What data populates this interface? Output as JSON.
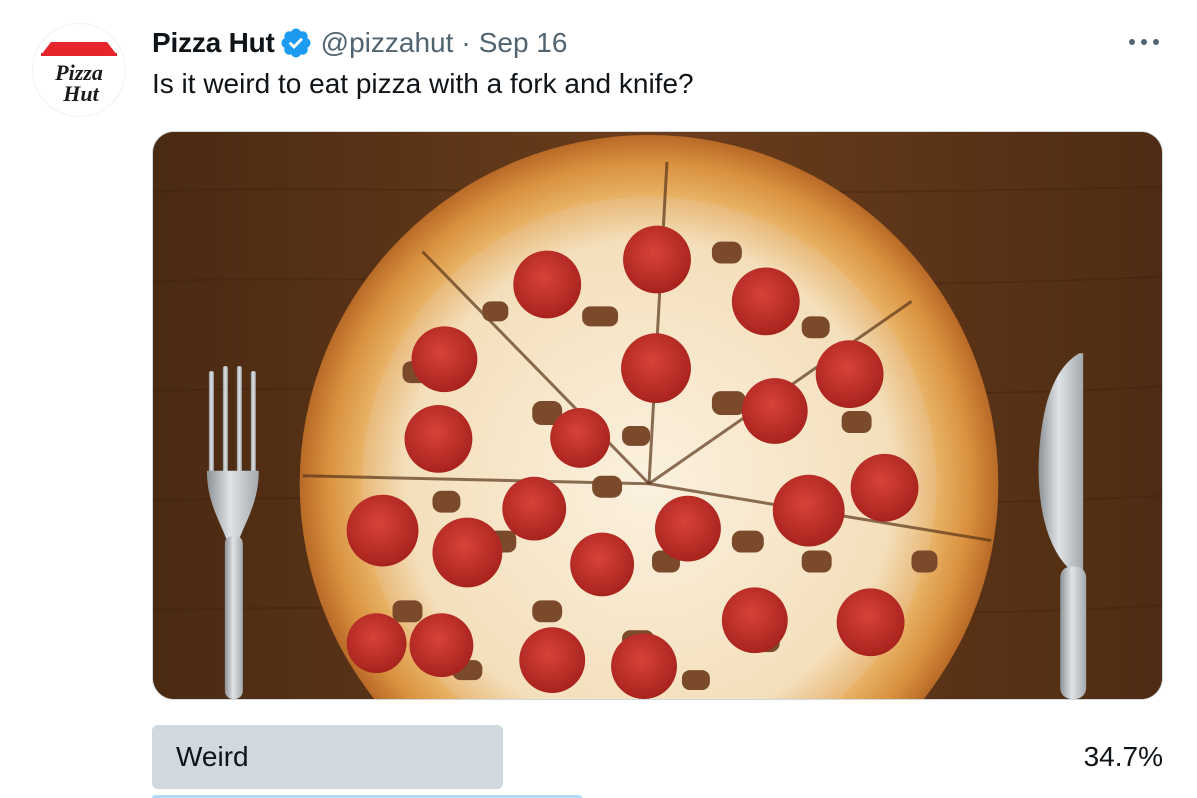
{
  "tweet": {
    "display_name": "Pizza Hut",
    "handle": "@pizzahut",
    "separator": "·",
    "timestamp": "Sep 16",
    "text": "Is it weird to eat pizza with a fork and knife?",
    "avatar_logo_text": [
      "Pizza",
      "Hut"
    ],
    "icons": {
      "verified": "verified-badge-icon",
      "more": "more-options-icon"
    },
    "colors": {
      "verified_blue": "#1d9bf0",
      "pizza_hut_red": "#e4252c",
      "poll_bar": "#cfd9de"
    }
  },
  "poll": {
    "options": [
      {
        "label": "Weird",
        "percent": "34.7%",
        "value": 0.347
      }
    ]
  }
}
